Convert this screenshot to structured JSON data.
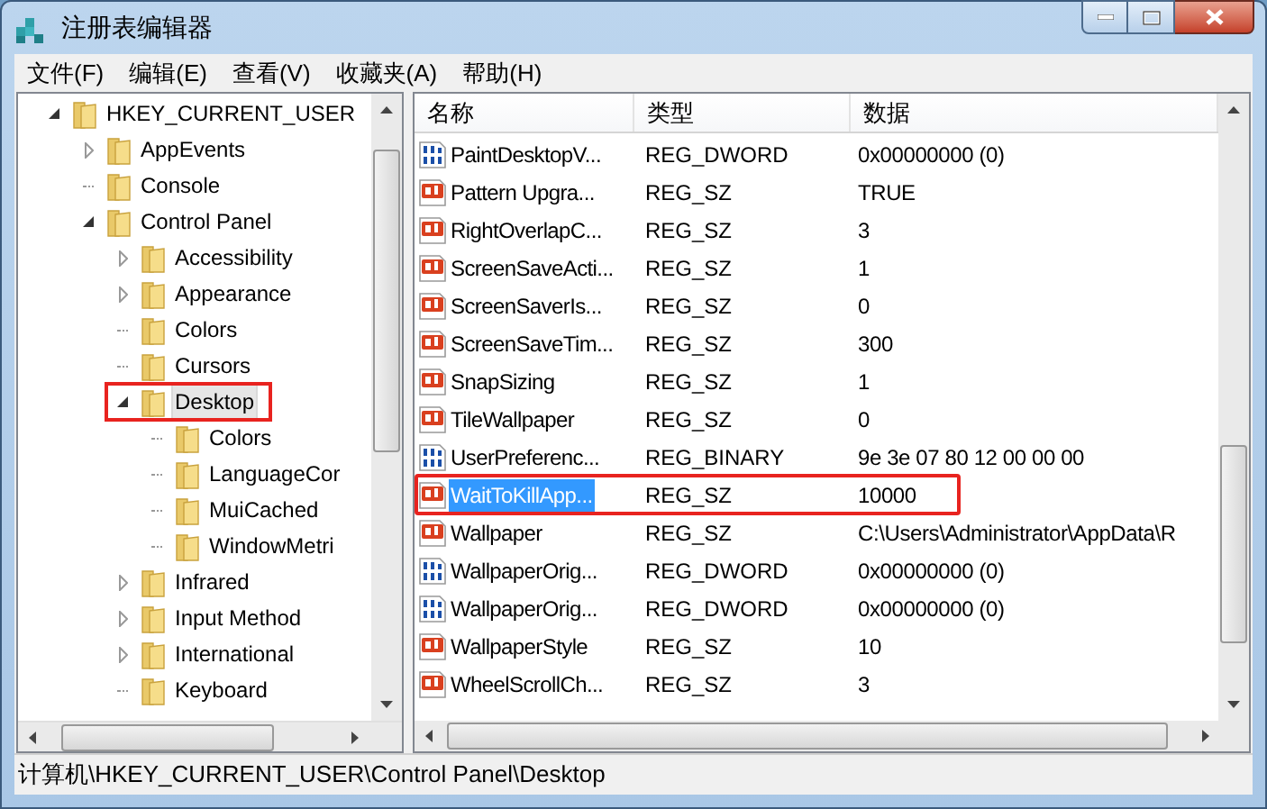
{
  "window": {
    "title": "注册表编辑器"
  },
  "menu": [
    "文件(F)",
    "编辑(E)",
    "查看(V)",
    "收藏夹(A)",
    "帮助(H)"
  ],
  "tree": [
    {
      "label": "HKEY_CURRENT_USER",
      "expandable": true,
      "expanded": true,
      "selected": false,
      "annotated": false,
      "children": [
        {
          "label": "AppEvents",
          "expandable": true,
          "expanded": false,
          "selected": false,
          "annotated": false
        },
        {
          "label": "Console",
          "expandable": false,
          "selected": false,
          "annotated": false
        },
        {
          "label": "Control Panel",
          "expandable": true,
          "expanded": true,
          "selected": false,
          "annotated": false,
          "children": [
            {
              "label": "Accessibility",
              "expandable": true,
              "expanded": false,
              "selected": false,
              "annotated": false
            },
            {
              "label": "Appearance",
              "expandable": true,
              "expanded": false,
              "selected": false,
              "annotated": false
            },
            {
              "label": "Colors",
              "expandable": false,
              "selected": false,
              "annotated": false
            },
            {
              "label": "Cursors",
              "expandable": false,
              "selected": false,
              "annotated": false
            },
            {
              "label": "Desktop",
              "expandable": true,
              "expanded": true,
              "selected": true,
              "annotated": true,
              "children": [
                {
                  "label": "Colors",
                  "expandable": false,
                  "selected": false,
                  "annotated": false
                },
                {
                  "label": "LanguageCor",
                  "expandable": false,
                  "selected": false,
                  "annotated": false
                },
                {
                  "label": "MuiCached",
                  "expandable": false,
                  "selected": false,
                  "annotated": false
                },
                {
                  "label": "WindowMetri",
                  "expandable": false,
                  "selected": false,
                  "annotated": false
                }
              ]
            },
            {
              "label": "Infrared",
              "expandable": true,
              "expanded": false,
              "selected": false,
              "annotated": false
            },
            {
              "label": "Input Method",
              "expandable": true,
              "expanded": false,
              "selected": false,
              "annotated": false
            },
            {
              "label": "International",
              "expandable": true,
              "expanded": false,
              "selected": false,
              "annotated": false
            },
            {
              "label": "Keyboard",
              "expandable": false,
              "selected": false,
              "annotated": false
            }
          ]
        }
      ]
    }
  ],
  "table": {
    "columns": [
      "名称",
      "类型",
      "数据"
    ],
    "rows": [
      {
        "kind": "binary",
        "name": "PaintDesktopV...",
        "type": "REG_DWORD",
        "data": "0x00000000 (0)",
        "selected": false,
        "annotated": false
      },
      {
        "kind": "string",
        "name": "Pattern Upgra...",
        "type": "REG_SZ",
        "data": "TRUE",
        "selected": false,
        "annotated": false
      },
      {
        "kind": "string",
        "name": "RightOverlapC...",
        "type": "REG_SZ",
        "data": "3",
        "selected": false,
        "annotated": false
      },
      {
        "kind": "string",
        "name": "ScreenSaveActi...",
        "type": "REG_SZ",
        "data": "1",
        "selected": false,
        "annotated": false
      },
      {
        "kind": "string",
        "name": "ScreenSaverIs...",
        "type": "REG_SZ",
        "data": "0",
        "selected": false,
        "annotated": false
      },
      {
        "kind": "string",
        "name": "ScreenSaveTim...",
        "type": "REG_SZ",
        "data": "300",
        "selected": false,
        "annotated": false
      },
      {
        "kind": "string",
        "name": "SnapSizing",
        "type": "REG_SZ",
        "data": "1",
        "selected": false,
        "annotated": false
      },
      {
        "kind": "string",
        "name": "TileWallpaper",
        "type": "REG_SZ",
        "data": "0",
        "selected": false,
        "annotated": false
      },
      {
        "kind": "binary",
        "name": "UserPreferenc...",
        "type": "REG_BINARY",
        "data": "9e 3e 07 80 12 00 00 00",
        "selected": false,
        "annotated": false
      },
      {
        "kind": "string",
        "name": "WaitToKillApp...",
        "type": "REG_SZ",
        "data": "10000",
        "selected": true,
        "annotated": true
      },
      {
        "kind": "string",
        "name": "Wallpaper",
        "type": "REG_SZ",
        "data": "C:\\Users\\Administrator\\AppData\\R",
        "selected": false,
        "annotated": false
      },
      {
        "kind": "binary",
        "name": "WallpaperOrig...",
        "type": "REG_DWORD",
        "data": "0x00000000 (0)",
        "selected": false,
        "annotated": false
      },
      {
        "kind": "binary",
        "name": "WallpaperOrig...",
        "type": "REG_DWORD",
        "data": "0x00000000 (0)",
        "selected": false,
        "annotated": false
      },
      {
        "kind": "string",
        "name": "WallpaperStyle",
        "type": "REG_SZ",
        "data": "10",
        "selected": false,
        "annotated": false
      },
      {
        "kind": "string",
        "name": "WheelScrollCh...",
        "type": "REG_SZ",
        "data": "3",
        "selected": false,
        "annotated": false
      }
    ]
  },
  "status_bar": "计算机\\HKEY_CURRENT_USER\\Control Panel\\Desktop"
}
